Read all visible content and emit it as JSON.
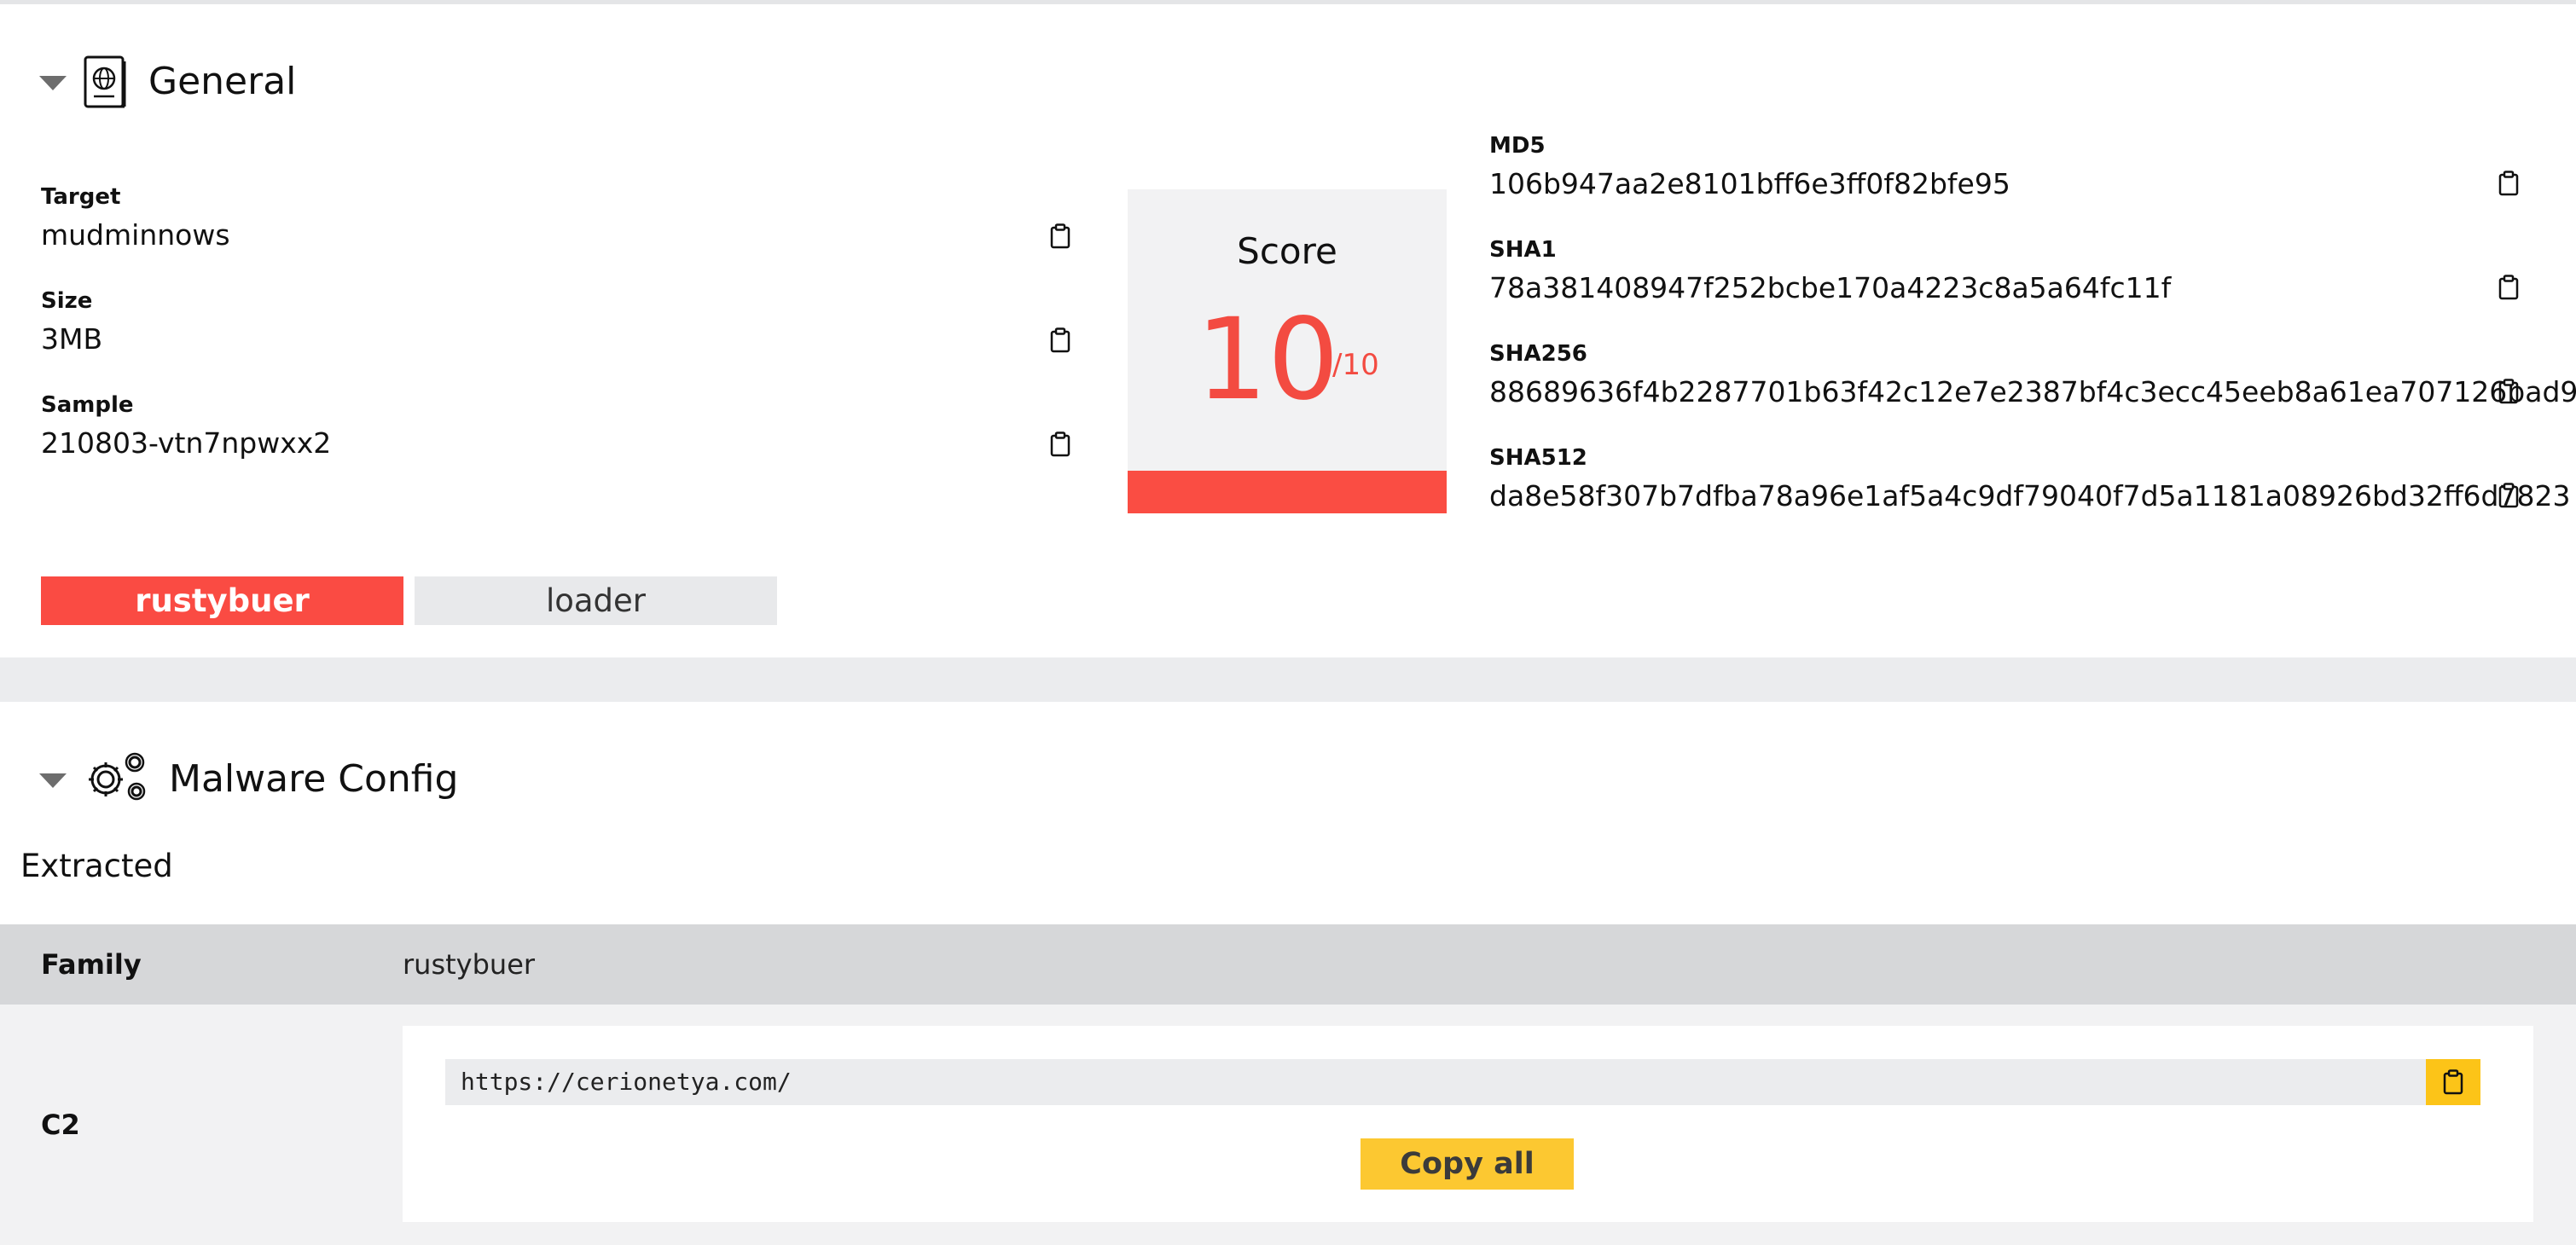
{
  "general": {
    "title": "General",
    "fields": [
      {
        "label": "Target",
        "value": "mudminnows"
      },
      {
        "label": "Size",
        "value": "3MB"
      },
      {
        "label": "Sample",
        "value": "210803-vtn7npwxx2"
      }
    ],
    "score": {
      "label": "Score",
      "value": "10",
      "max": "/10",
      "level": 1.0
    },
    "hashes": [
      {
        "label": "MD5",
        "value": "106b947aa2e8101bff6e3ff0f82bfe95"
      },
      {
        "label": "SHA1",
        "value": "78a381408947f252bcbe170a4223c8a5a64fc11f"
      },
      {
        "label": "SHA256",
        "value": "88689636f4b2287701b63f42c12e7e2387bf4c3ecc45eeb8a61ea707126bad9"
      },
      {
        "label": "SHA512",
        "value": "da8e58f307b7dfba78a96e1af5a4c9df79040f7d5a1181a08926bd32ff6d7823"
      }
    ],
    "tags": [
      "rustybuer",
      "loader"
    ]
  },
  "malware_config": {
    "title": "Malware Config",
    "subtitle": "Extracted",
    "family_label": "Family",
    "family_value": "rustybuer",
    "c2_label": "C2",
    "c2_url": "https://cerionetya.com/",
    "copy_all_label": "Copy all"
  },
  "colors": {
    "accent_red": "#fa4b43",
    "copy_yellow": "#fcc418",
    "section_gray": "#ebecee"
  },
  "icons": {
    "general": "passport-globe-icon",
    "malware_config": "gears-icon",
    "copy": "clipboard-icon",
    "collapse": "caret-down-icon"
  }
}
